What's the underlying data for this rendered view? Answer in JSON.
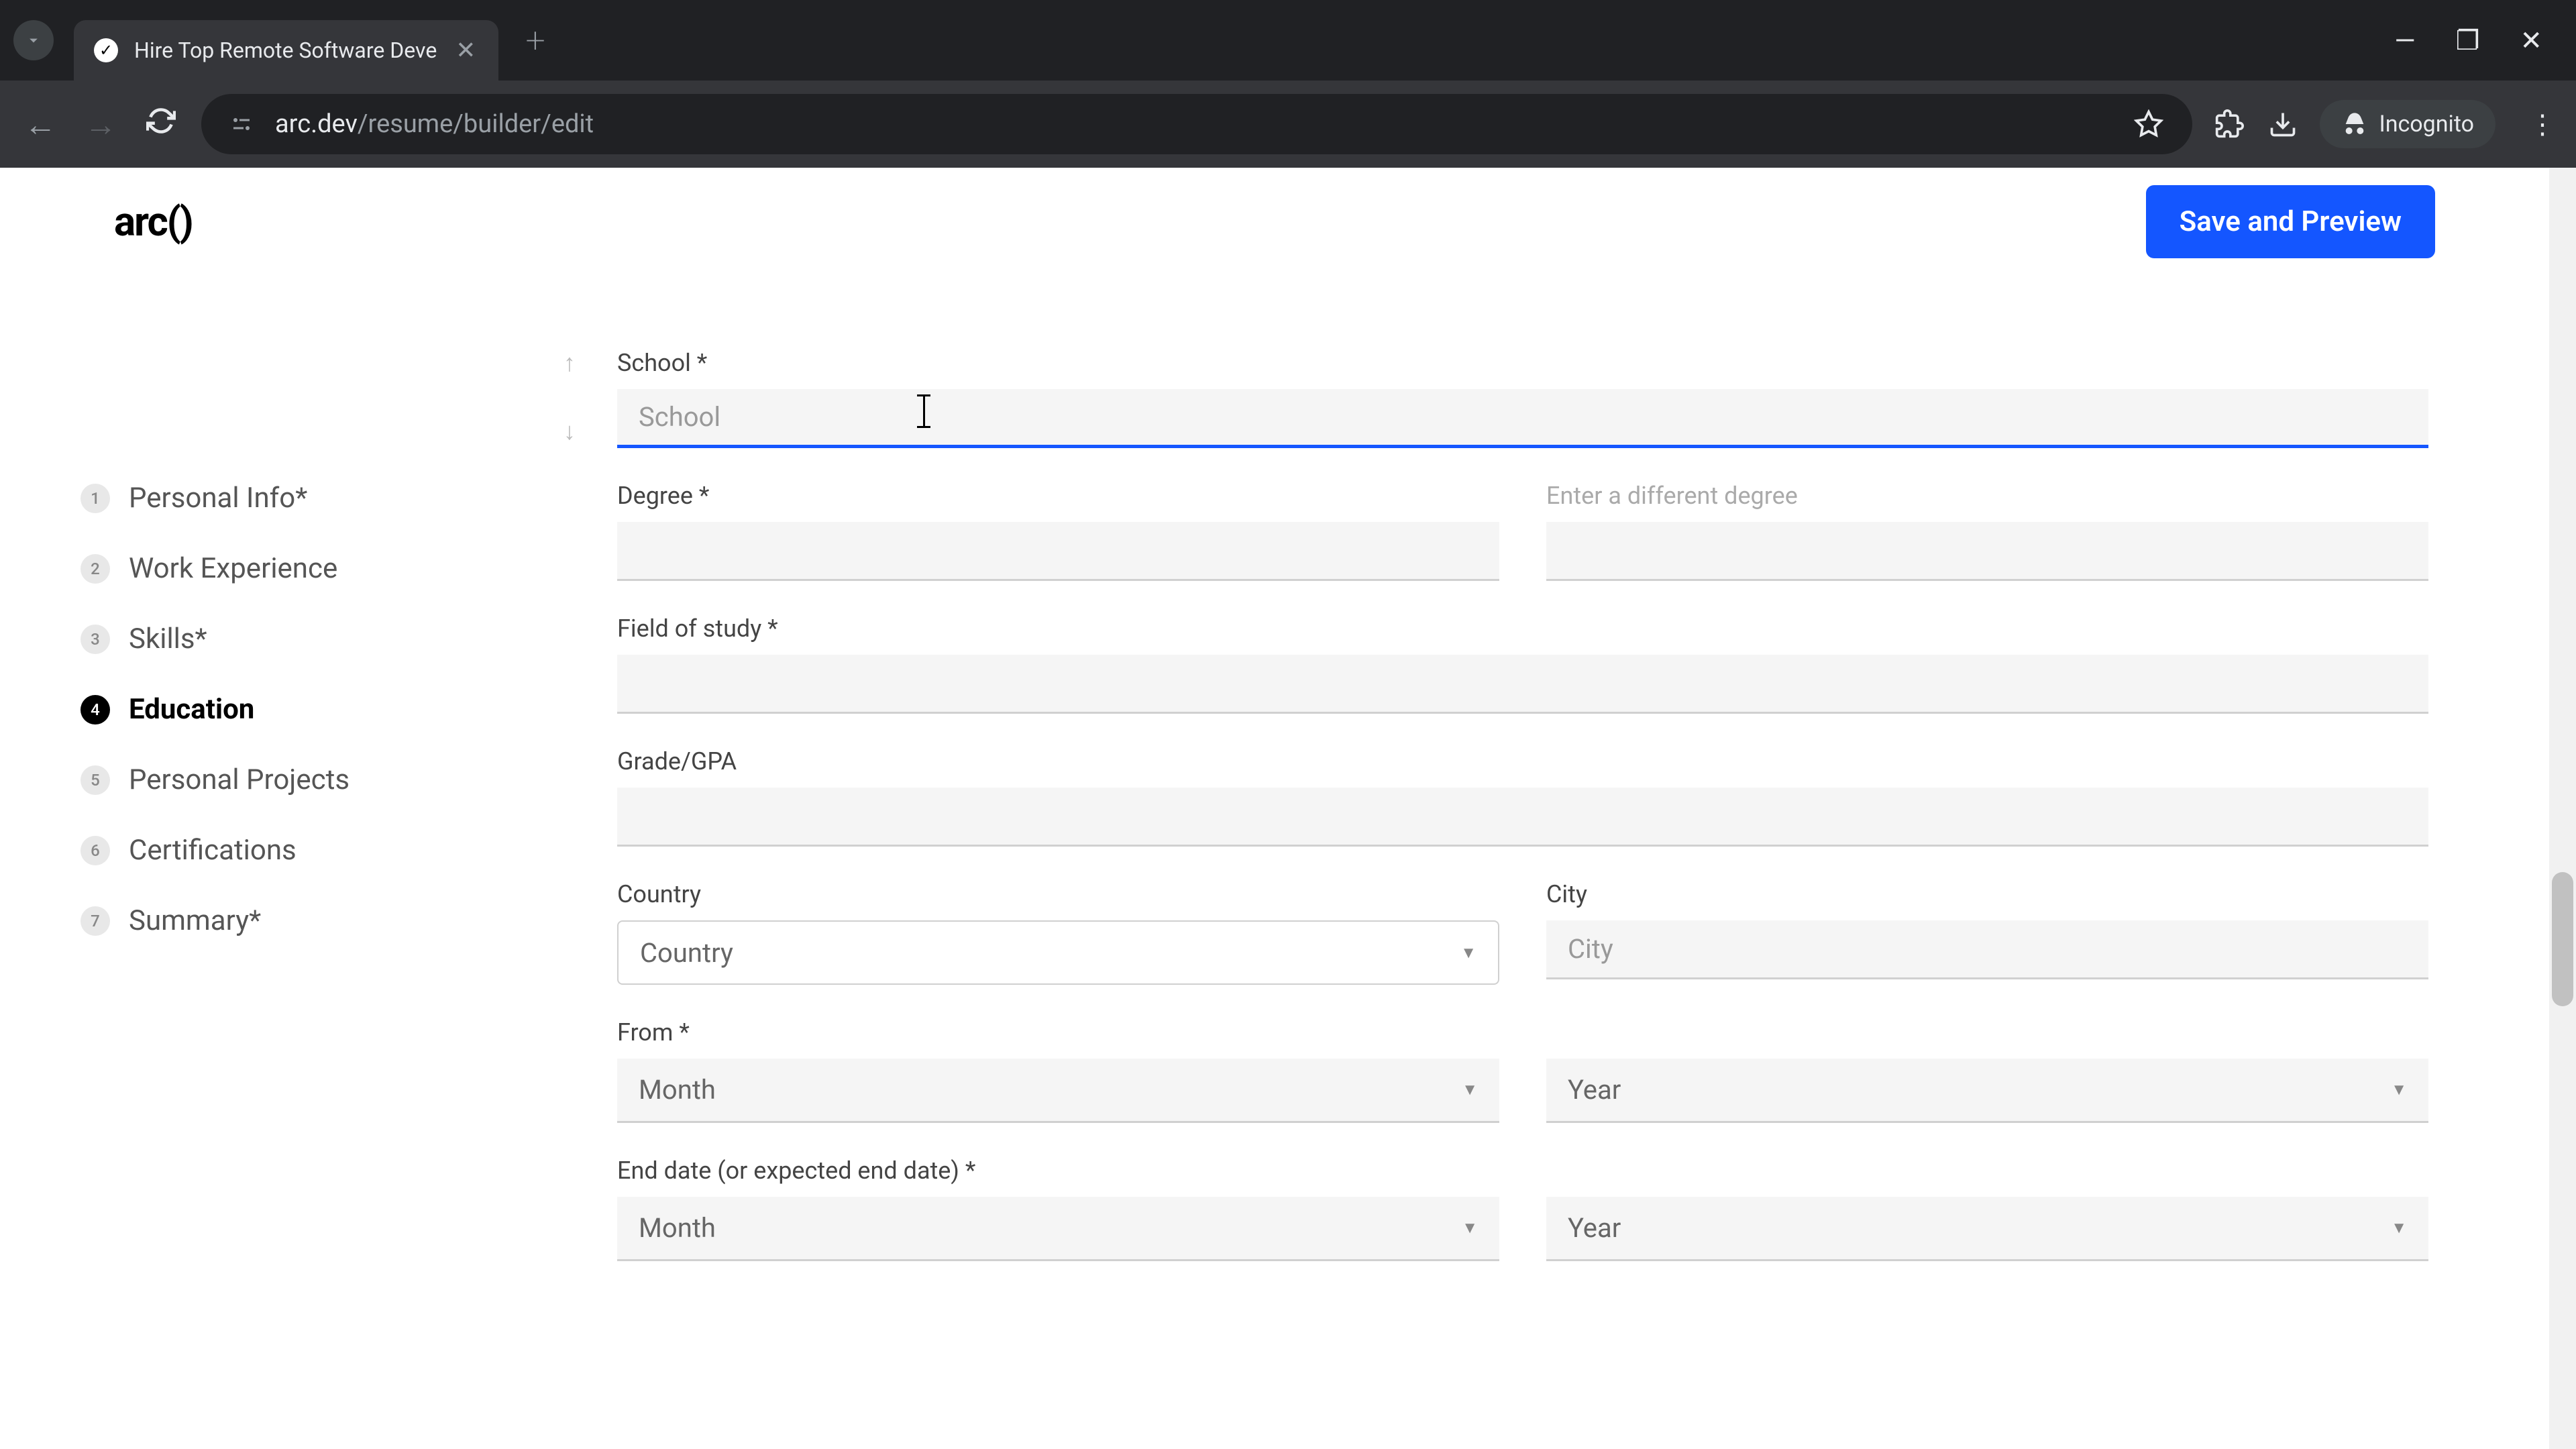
{
  "browser": {
    "tab_title": "Hire Top Remote Software Deve",
    "url_host": "arc.dev",
    "url_path": "/resume/builder/edit",
    "incognito_label": "Incognito"
  },
  "header": {
    "logo": "arc()",
    "save_button": "Save and Preview"
  },
  "sidebar": {
    "steps": [
      {
        "num": "1",
        "label": "Personal Info*"
      },
      {
        "num": "2",
        "label": "Work Experience"
      },
      {
        "num": "3",
        "label": "Skills*"
      },
      {
        "num": "4",
        "label": "Education"
      },
      {
        "num": "5",
        "label": "Personal Projects"
      },
      {
        "num": "6",
        "label": "Certifications"
      },
      {
        "num": "7",
        "label": "Summary*"
      }
    ],
    "active_index": 3
  },
  "form": {
    "school_label": "School *",
    "school_placeholder": "School",
    "degree_label": "Degree *",
    "diff_degree_label": "Enter a different degree",
    "field_of_study_label": "Field of study *",
    "grade_label": "Grade/GPA",
    "country_label": "Country",
    "country_placeholder": "Country",
    "city_label": "City",
    "city_placeholder": "City",
    "from_label": "From *",
    "month_placeholder": "Month",
    "year_placeholder": "Year",
    "end_label": "End date (or expected end date) *"
  }
}
